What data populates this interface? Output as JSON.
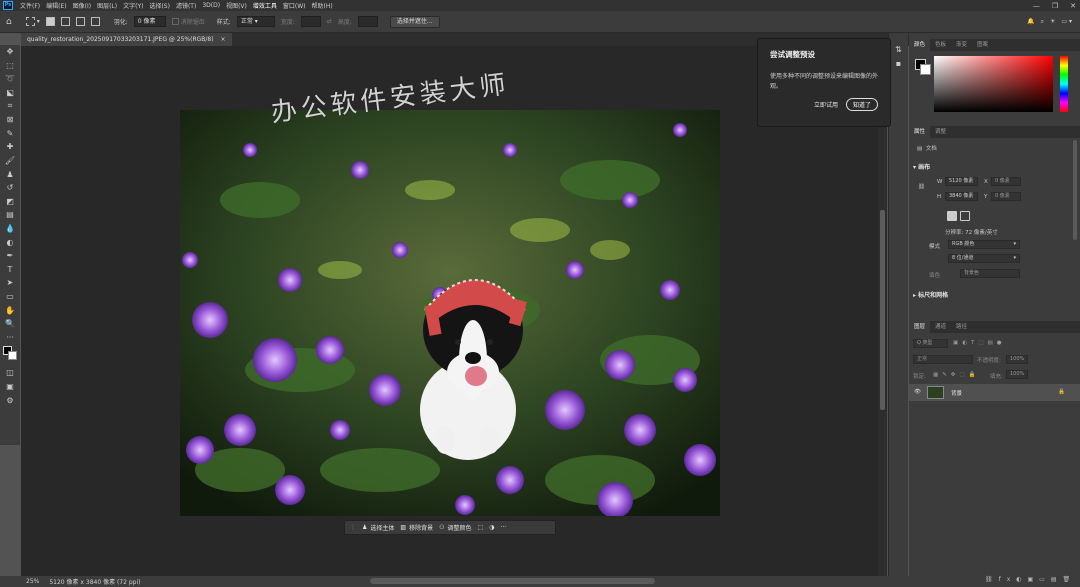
{
  "menu": {
    "logo": "Ps",
    "items": [
      "文件(F)",
      "编辑(E)",
      "图像(I)",
      "图层(L)",
      "文字(Y)",
      "选择(S)",
      "滤镜(T)",
      "3D(D)",
      "视图(V)",
      "增效工具",
      "窗口(W)",
      "帮助(H)"
    ]
  },
  "window_controls": [
    "—",
    "❐",
    "✕"
  ],
  "options": {
    "feather_label": "羽化:",
    "feather_value": "0 像素",
    "antialias": "消除锯齿",
    "style_label": "样式:",
    "style_value": "正常",
    "width_label": "宽度:",
    "height_label": "高度:",
    "select_mask": "选择并遮住..."
  },
  "tab": {
    "title": "quality_restoration_20250917033203171.JPEG @ 25%(RGB/8)",
    "close": "×"
  },
  "watermark": "办公软件安装大师",
  "context_bar": {
    "select_subject": "选择主体",
    "remove_bg": "移除背景",
    "adjust_color": "调整颜色"
  },
  "status": {
    "zoom": "25%",
    "info": "5120 像素 x 3840 像素 (72 ppi)"
  },
  "popover": {
    "title": "尝试调整预设",
    "desc": "使用多种不同的调整预设来编辑图像的外观。",
    "try_now": "立即试用",
    "got_it": "知道了"
  },
  "color_panel": {
    "tabs": [
      "颜色",
      "色板",
      "渐变",
      "图案"
    ]
  },
  "props_panel": {
    "tabs": [
      "属性",
      "调整"
    ],
    "doc_label": "文档",
    "canvas_title": "画布",
    "w_label": "W",
    "w_value": "5120 像素",
    "h_label": "H",
    "h_value": "3840 像素",
    "x_label": "X",
    "y_label": "Y",
    "x_placeholder": "0 像素",
    "y_placeholder": "0 像素",
    "resolution": "分辨率: 72 像素/英寸",
    "mode_label": "模式",
    "mode_value": "RGB 颜色",
    "depth_value": "8 位/通道",
    "fill_label": "填色",
    "fill_value": "背景色",
    "rulers_title": "标尺和网格"
  },
  "layers_panel": {
    "tabs": [
      "图层",
      "通道",
      "路径"
    ],
    "kind_label": "Q 类型",
    "blend_value": "正常",
    "opacity_label": "不透明度:",
    "opacity_value": "100%",
    "lock_label": "锁定:",
    "fill_label": "填充:",
    "fill_value": "100%",
    "layer_name": "背景"
  },
  "colors": {
    "accent": "#31a8ff",
    "bg": "#535353",
    "panel": "#3c3c3c"
  }
}
